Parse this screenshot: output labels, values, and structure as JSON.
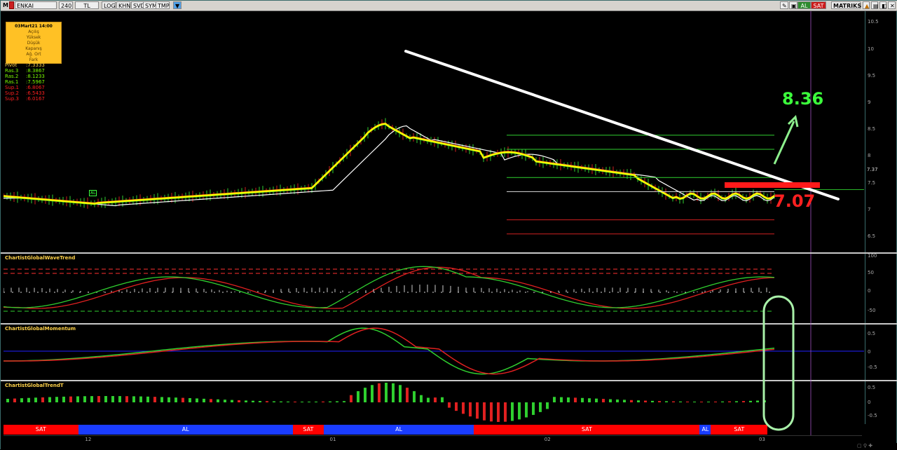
{
  "toolbar": {
    "symbol": "ENKAI",
    "period": "240",
    "currency": "TL",
    "buttons": [
      "LOG",
      "KHN",
      "SVD",
      "SYM",
      "TMP"
    ],
    "app_name": "MATRIKS",
    "al_label": "AL",
    "sat_label": "SAT",
    "icons": [
      "pencil-icon",
      "lock-icon",
      "warning-icon",
      "chart-icon",
      "close-icon"
    ]
  },
  "infobox": {
    "date": "03Mart21 14:00",
    "rows": [
      "Açılış",
      "Yüksek",
      "Düşük",
      "Kapanış",
      "Ağ. Ort",
      "Fark"
    ]
  },
  "pivots": [
    {
      "label": "Pivot",
      "value": ":7.3333",
      "color": "#ffd24a"
    },
    {
      "label": "Ras.3",
      "value": ":8.3867",
      "color": "#7cfc00"
    },
    {
      "label": "Ras.2",
      "value": ":8.1233",
      "color": "#7cfc00"
    },
    {
      "label": "Ras.1",
      "value": ":7.5967",
      "color": "#7cfc00"
    },
    {
      "label": "Sup.1",
      "value": ":6.8067",
      "color": "#ff2020"
    },
    {
      "label": "Sup.2",
      "value": ":6.5433",
      "color": "#ff2020"
    },
    {
      "label": "Sup.3",
      "value": ":6.0167",
      "color": "#ff2020"
    }
  ],
  "main_chart": {
    "yticks": [
      "10.5",
      "10",
      "9.5",
      "9",
      "8.5",
      "8",
      "7.5",
      "7",
      "6.5"
    ],
    "ymin": 6.2,
    "ymax": 10.7,
    "last_price_label": "7.37",
    "al_marker": "AL",
    "target_label": "8.36",
    "support_label": "7.07",
    "colors": {
      "target": "#3cff3c",
      "support": "#ff2020",
      "trendline": "#ffffff",
      "price_line": "#ffff00"
    }
  },
  "panes": {
    "wavetrend": {
      "title": "ChartistGlobalWaveTrend",
      "yticks": [
        "100",
        "50",
        "0",
        "-50"
      ]
    },
    "momentum": {
      "title": "ChartistGlobalMomentum",
      "yticks": [
        "0.5",
        "0",
        "-0.5"
      ]
    },
    "trendt": {
      "title": "ChartistGlobalTrendT",
      "yticks": [
        "0.5",
        "0",
        "-0.5"
      ]
    }
  },
  "signal_band": [
    {
      "label": "SAT",
      "start": 0,
      "end": 0.087,
      "color": "#ff0000"
    },
    {
      "label": "AL",
      "start": 0.087,
      "end": 0.337,
      "color": "#1a3cff"
    },
    {
      "label": "SAT",
      "start": 0.337,
      "end": 0.373,
      "color": "#ff0000"
    },
    {
      "label": "AL",
      "start": 0.373,
      "end": 0.548,
      "color": "#1a3cff"
    },
    {
      "label": "SAT",
      "start": 0.548,
      "end": 0.811,
      "color": "#ff0000"
    },
    {
      "label": "AL",
      "start": 0.811,
      "end": 0.824,
      "color": "#1a3cff"
    },
    {
      "label": "SAT",
      "start": 0.824,
      "end": 0.89,
      "color": "#ff0000"
    }
  ],
  "date_labels": [
    {
      "label": "12",
      "pos": 0.095
    },
    {
      "label": "01",
      "pos": 0.38
    },
    {
      "label": "02",
      "pos": 0.63
    },
    {
      "label": "03",
      "pos": 0.88
    }
  ]
}
